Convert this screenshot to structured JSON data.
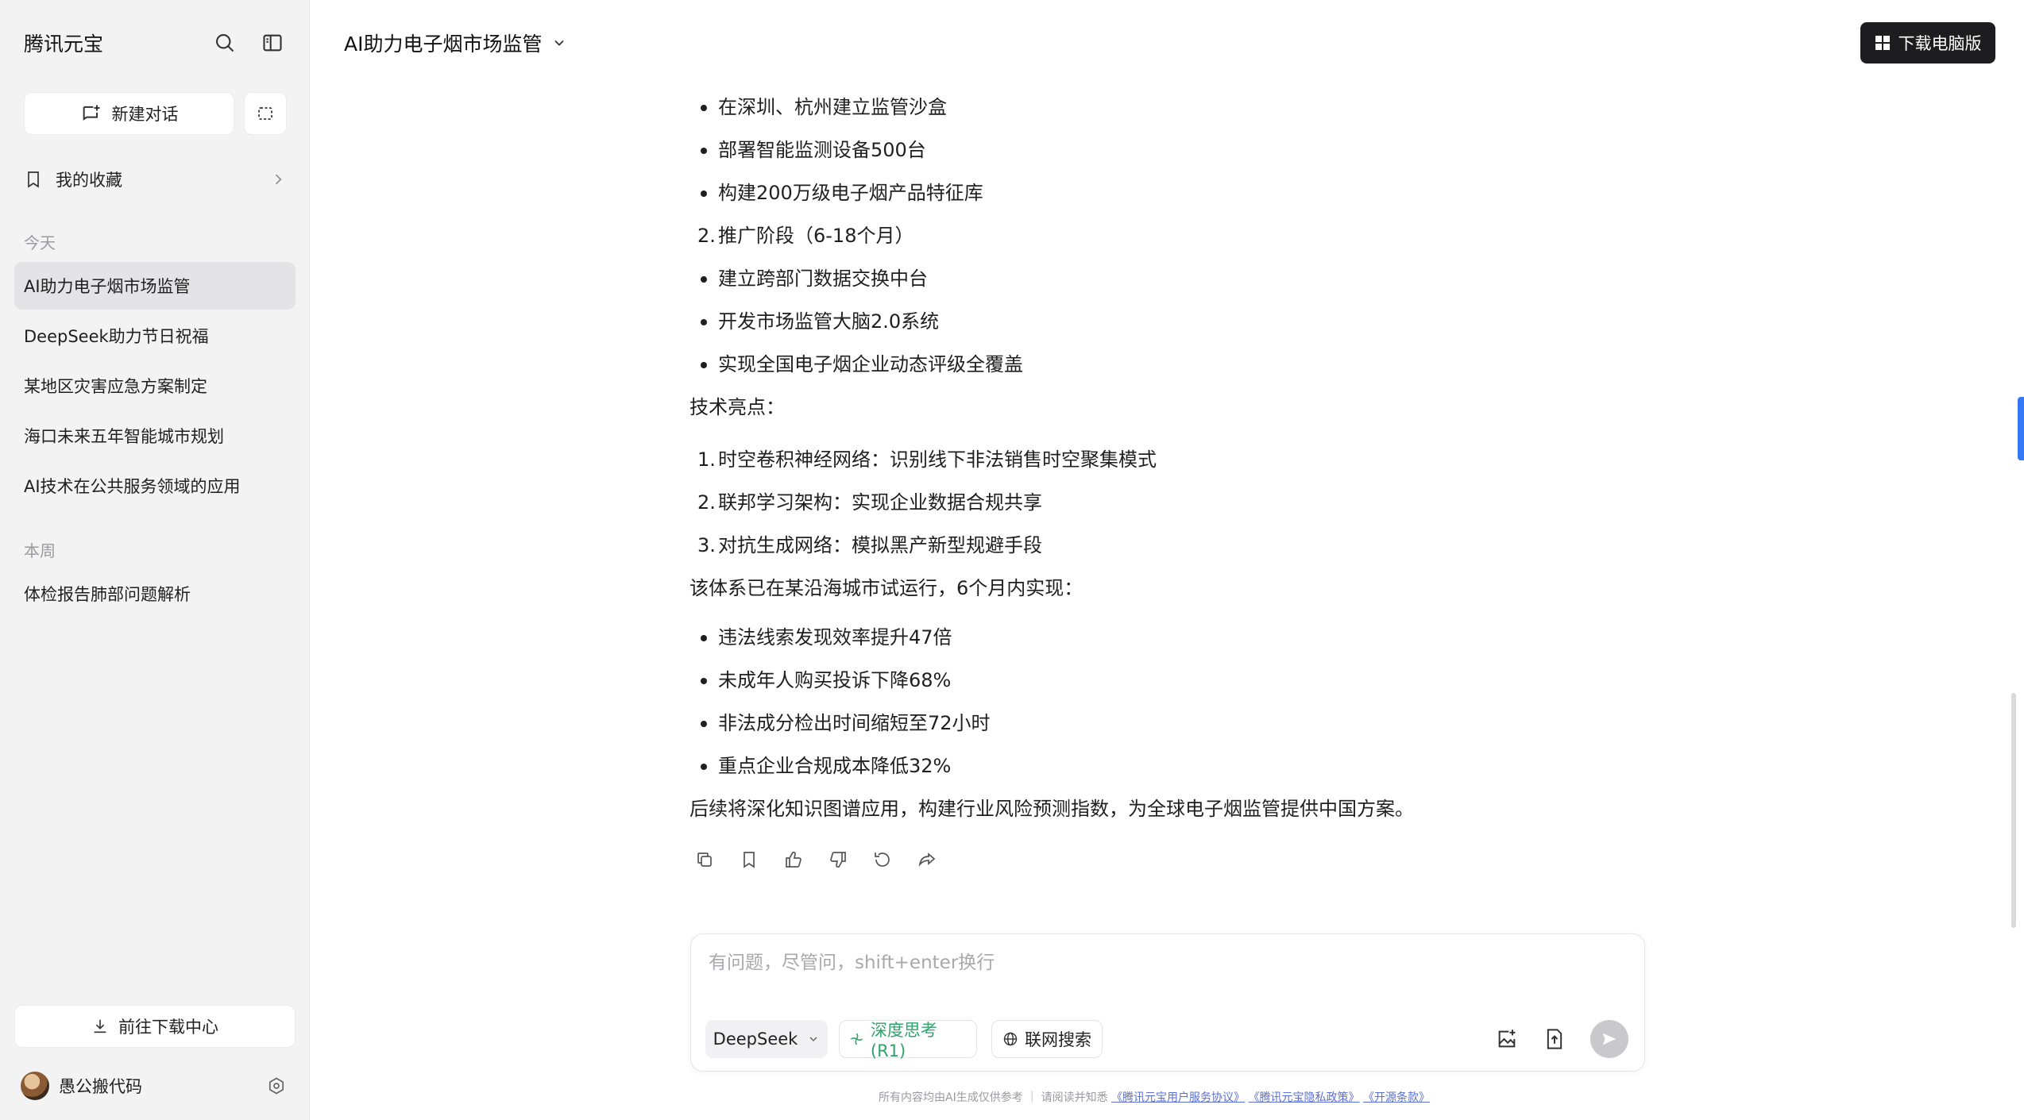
{
  "sidebar": {
    "brand": "腾讯元宝",
    "new_chat": "新建对话",
    "favorites": "我的收藏",
    "today_label": "今天",
    "today_items": [
      "AI助力电子烟市场监管",
      "DeepSeek助力节日祝福",
      "某地区灾害应急方案制定",
      "海口未来五年智能城市规划",
      "AI技术在公共服务领域的应用"
    ],
    "week_label": "本周",
    "week_items": [
      "体检报告肺部问题解析"
    ],
    "download_center": "前往下载中心",
    "user_name": "愚公搬代码"
  },
  "header": {
    "conversation_title": "AI助力电子烟市场监管",
    "download_pc": "下载电脑版"
  },
  "content": {
    "lines": [
      "在深圳、杭州建立监管沙盒",
      "部署智能监测设备500台",
      "构建200万级电子烟产品特征库",
      "推广阶段（6-18个月）",
      "建立跨部门数据交换中台",
      "开发市场监管大脑2.0系统",
      "实现全国电子烟企业动态评级全覆盖",
      "技术亮点：",
      "时空卷积神经网络：识别线下非法销售时空聚集模式",
      "联邦学习架构：实现企业数据合规共享",
      "对抗生成网络：模拟黑产新型规避手段",
      "该体系已在某沿海城市试运行，6个月内实现：",
      "违法线索发现效率提升47倍",
      "未成年人购买投诉下降68%",
      "非法成分检出时间缩短至72小时",
      "重点企业合规成本降低32%",
      "后续将深化知识图谱应用，构建行业风险预测指数，为全球电子烟监管提供中国方案。"
    ],
    "numbers": [
      "2.",
      "1.",
      "2.",
      "3."
    ]
  },
  "input": {
    "placeholder": "有问题，尽管问，shift+enter换行",
    "model": "DeepSeek",
    "deep_think": "深度思考(R1)",
    "web_search": "联网搜索"
  },
  "footer": {
    "prefix": "所有内容均由AI生成仅供参考 ｜ 请阅读并知悉",
    "link1": "《腾讯元宝用户服务协议》",
    "link2": "《腾讯元宝隐私政策》",
    "link3": "《开源条款》"
  },
  "colors": {
    "accent_green": "#2fa36b",
    "sidebar_bg": "#f3f3f4",
    "dark_button": "#1d1d1f",
    "link": "#5b6fd6"
  }
}
